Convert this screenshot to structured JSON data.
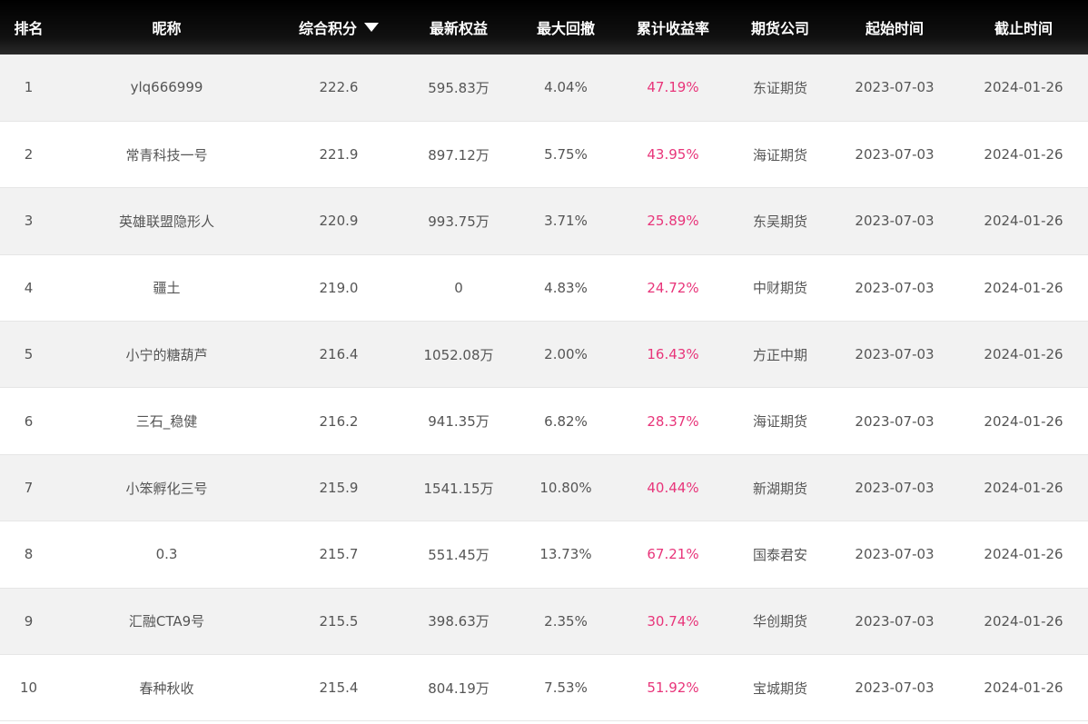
{
  "table": {
    "headers": {
      "rank": "排名",
      "nickname": "昵称",
      "score": "综合积分",
      "equity": "最新权益",
      "drawdown": "最大回撤",
      "return": "累计收益率",
      "company": "期货公司",
      "start": "起始时间",
      "end": "截止时间"
    },
    "sort_icon": "triangle-down-icon",
    "accent_color": "#e8357a",
    "rows": [
      {
        "rank": "1",
        "nickname": "ylq666999",
        "score": "222.6",
        "equity": "595.83万",
        "drawdown": "4.04%",
        "return": "47.19%",
        "company": "东证期货",
        "start": "2023-07-03",
        "end": "2024-01-26"
      },
      {
        "rank": "2",
        "nickname": "常青科技一号",
        "score": "221.9",
        "equity": "897.12万",
        "drawdown": "5.75%",
        "return": "43.95%",
        "company": "海证期货",
        "start": "2023-07-03",
        "end": "2024-01-26"
      },
      {
        "rank": "3",
        "nickname": "英雄联盟隐形人",
        "score": "220.9",
        "equity": "993.75万",
        "drawdown": "3.71%",
        "return": "25.89%",
        "company": "东吴期货",
        "start": "2023-07-03",
        "end": "2024-01-26"
      },
      {
        "rank": "4",
        "nickname": "疆土",
        "score": "219.0",
        "equity": "0",
        "drawdown": "4.83%",
        "return": "24.72%",
        "company": "中财期货",
        "start": "2023-07-03",
        "end": "2024-01-26"
      },
      {
        "rank": "5",
        "nickname": "小宁的糖葫芦",
        "score": "216.4",
        "equity": "1052.08万",
        "drawdown": "2.00%",
        "return": "16.43%",
        "company": "方正中期",
        "start": "2023-07-03",
        "end": "2024-01-26"
      },
      {
        "rank": "6",
        "nickname": "三石_稳健",
        "score": "216.2",
        "equity": "941.35万",
        "drawdown": "6.82%",
        "return": "28.37%",
        "company": "海证期货",
        "start": "2023-07-03",
        "end": "2024-01-26"
      },
      {
        "rank": "7",
        "nickname": "小笨孵化三号",
        "score": "215.9",
        "equity": "1541.15万",
        "drawdown": "10.80%",
        "return": "40.44%",
        "company": "新湖期货",
        "start": "2023-07-03",
        "end": "2024-01-26"
      },
      {
        "rank": "8",
        "nickname": "0.3",
        "score": "215.7",
        "equity": "551.45万",
        "drawdown": "13.73%",
        "return": "67.21%",
        "company": "国泰君安",
        "start": "2023-07-03",
        "end": "2024-01-26"
      },
      {
        "rank": "9",
        "nickname": "汇融CTA9号",
        "score": "215.5",
        "equity": "398.63万",
        "drawdown": "2.35%",
        "return": "30.74%",
        "company": "华创期货",
        "start": "2023-07-03",
        "end": "2024-01-26"
      },
      {
        "rank": "10",
        "nickname": "春种秋收",
        "score": "215.4",
        "equity": "804.19万",
        "drawdown": "7.53%",
        "return": "51.92%",
        "company": "宝城期货",
        "start": "2023-07-03",
        "end": "2024-01-26"
      }
    ]
  }
}
